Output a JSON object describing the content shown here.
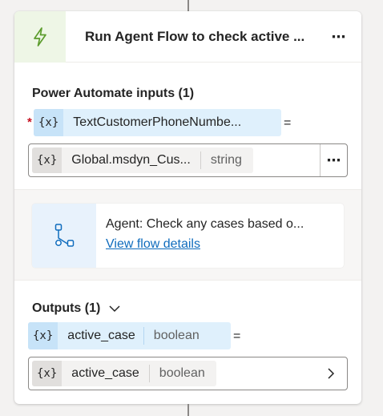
{
  "node": {
    "title": "Run Agent Flow to check active ...",
    "header_icon": "lightning-bolt-icon",
    "more_icon": "more-horizontal-icon",
    "more_glyph": "⋯"
  },
  "inputs": {
    "section_title": "Power Automate inputs (1)",
    "required_marker": "*",
    "variable": {
      "x_glyph": "{x}",
      "name": "TextCustomerPhoneNumbe...",
      "eq": "="
    },
    "value": {
      "x_glyph": "{x}",
      "name": "Global.msdyn_Cus...",
      "type": "string",
      "more_glyph": "⋯"
    }
  },
  "flow": {
    "icon": "flow-connector-icon",
    "description": "Agent: Check any cases based o...",
    "link_label": "View flow details"
  },
  "outputs": {
    "section_title": "Outputs (1)",
    "chevron_icon": "chevron-down-icon",
    "variable": {
      "x_glyph": "{x}",
      "name": "active_case",
      "type": "boolean",
      "eq": "="
    },
    "value": {
      "x_glyph": "{x}",
      "name": "active_case",
      "type": "boolean",
      "chevron_icon": "chevron-right-icon"
    }
  },
  "colors": {
    "accent_green_bg": "#eef6e6",
    "bolt_green": "#5c9c2d",
    "variable_pill_bg": "#dff0fc",
    "flow_icon_bg": "#e8f2fc",
    "flow_icon_stroke": "#0f6cbd",
    "link": "#0f6cbd",
    "required": "#c50f1f"
  }
}
